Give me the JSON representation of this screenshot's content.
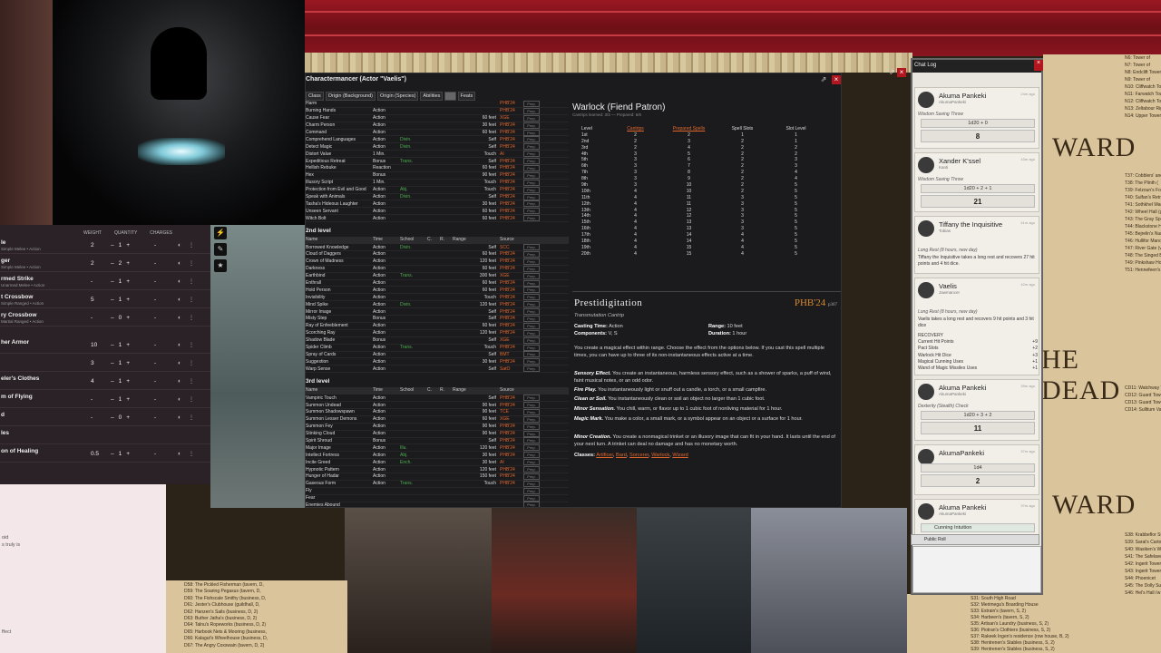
{
  "sheet": {
    "title": "Charactermancer (Actor \"Vaelis\")",
    "tabs": [
      "Class",
      "Origin (Background)",
      "Origin (Species)",
      "Abilities",
      "Feats",
      "Feats"
    ],
    "level1": [
      [
        "Harm",
        "",
        "",
        "",
        "",
        "PHB'24"
      ],
      [
        "Burning Hands",
        "Action",
        "",
        "",
        "",
        "PHB'24"
      ],
      [
        "Cause Fear",
        "Action",
        "",
        "",
        "60 feet",
        "XGE"
      ],
      [
        "Charm Person",
        "Action",
        "",
        "",
        "30 feet",
        "PHB'24"
      ],
      [
        "Command",
        "Action",
        "",
        "",
        "60 feet",
        "PHB'24"
      ],
      [
        "Comprehend Languages",
        "Action",
        "Divin.",
        "",
        "Self",
        "PHB'24"
      ],
      [
        "Detect Magic",
        "Action",
        "Divin.",
        "",
        "Self",
        "PHB'24"
      ],
      [
        "Distort Value",
        "1 Min.",
        "",
        "",
        "Touch",
        "AI"
      ],
      [
        "Expeditious Retreat",
        "Bonus",
        "Trans.",
        "",
        "Self",
        "PHB'24"
      ],
      [
        "Hellish Rebuke",
        "Reaction",
        "",
        "",
        "60 feet",
        "PHB'24"
      ],
      [
        "Hex",
        "Bonus",
        "",
        "",
        "90 feet",
        "PHB'24"
      ],
      [
        "Illusory Script",
        "1 Min.",
        "",
        "",
        "Touch",
        "PHB'24"
      ],
      [
        "Protection from Evil and Good",
        "Action",
        "Abj.",
        "",
        "Touch",
        "PHB'24"
      ],
      [
        "Speak with Animals",
        "Action",
        "Divin.",
        "",
        "Self",
        "PHB'24"
      ],
      [
        "Tasha's Hideous Laughter",
        "Action",
        "",
        "",
        "30 feet",
        "PHB'24"
      ],
      [
        "Unseen Servant",
        "Action",
        "",
        "",
        "60 feet",
        "PHB'24"
      ],
      [
        "Witch Bolt",
        "Action",
        "",
        "",
        "60 feet",
        "PHB'24"
      ]
    ],
    "level2_label": "2nd level",
    "col_headers": {
      "name": "Name",
      "time": "Time",
      "school": "School",
      "c": "C.",
      "r": "R.",
      "range": "Range",
      "source": "Source"
    },
    "level2": [
      [
        "Borrowed Knowledge",
        "Action",
        "Divin.",
        "",
        "Self",
        "SCC"
      ],
      [
        "Cloud of Daggers",
        "Action",
        "",
        "",
        "60 feet",
        "PHB'24"
      ],
      [
        "Crown of Madness",
        "Action",
        "",
        "",
        "120 feet",
        "PHB'24"
      ],
      [
        "Darkness",
        "Action",
        "",
        "",
        "60 feet",
        "PHB'24"
      ],
      [
        "Earthbind",
        "Action",
        "Trans.",
        "",
        "300 feet",
        "XGE"
      ],
      [
        "Enthrall",
        "Action",
        "",
        "",
        "60 feet",
        "PHB'24"
      ],
      [
        "Hold Person",
        "Action",
        "",
        "",
        "60 feet",
        "PHB'24"
      ],
      [
        "Invisibility",
        "Action",
        "",
        "",
        "Touch",
        "PHB'24"
      ],
      [
        "Mind Spike",
        "Action",
        "Divin.",
        "",
        "120 feet",
        "PHB'24"
      ],
      [
        "Mirror Image",
        "Action",
        "",
        "",
        "Self",
        "PHB'24"
      ],
      [
        "Misty Step",
        "Bonus",
        "",
        "",
        "Self",
        "PHB'24"
      ],
      [
        "Ray of Enfeeblement",
        "Action",
        "",
        "",
        "60 feet",
        "PHB'24"
      ],
      [
        "Scorching Ray",
        "Action",
        "",
        "",
        "120 feet",
        "PHB'24"
      ],
      [
        "Shadow Blade",
        "Bonus",
        "",
        "",
        "Self",
        "XGE"
      ],
      [
        "Spider Climb",
        "Action",
        "Trans.",
        "",
        "Touch",
        "PHB'24"
      ],
      [
        "Spray of Cards",
        "Action",
        "",
        "",
        "Self",
        "BMT"
      ],
      [
        "Suggestion",
        "Action",
        "",
        "",
        "30 feet",
        "PHB'24"
      ],
      [
        "Warp Sense",
        "Action",
        "",
        "",
        "Self",
        "SatO"
      ]
    ],
    "level3_label": "3rd level",
    "level3": [
      [
        "Vampiric Touch",
        "Action",
        "",
        "",
        "Self",
        "PHB'24"
      ],
      [
        "Summon Undead",
        "Action",
        "",
        "",
        "90 feet",
        "PHB'24"
      ],
      [
        "Summon Shadowspawn",
        "Action",
        "",
        "",
        "90 feet",
        "TCE"
      ],
      [
        "Summon Lesser Demons",
        "Action",
        "",
        "",
        "60 feet",
        "XGE"
      ],
      [
        "Summon Fey",
        "Action",
        "",
        "",
        "90 feet",
        "PHB'24"
      ],
      [
        "Stinking Cloud",
        "Action",
        "",
        "",
        "90 feet",
        "PHB'24"
      ],
      [
        "Spirit Shroud",
        "Bonus",
        "",
        "",
        "Self",
        "PHB'24"
      ],
      [
        "Major Image",
        "Action",
        "Illu.",
        "",
        "120 feet",
        "PHB'24"
      ],
      [
        "Intellect Fortress",
        "Action",
        "Abj.",
        "",
        "30 feet",
        "PHB'24"
      ],
      [
        "Incite Greed",
        "Action",
        "Ench.",
        "",
        "30 feet",
        "AI"
      ],
      [
        "Hypnotic Pattern",
        "Action",
        "",
        "",
        "120 feet",
        "PHB'24"
      ],
      [
        "Hunger of Hadar",
        "Action",
        "",
        "",
        "150 feet",
        "PHB'24"
      ],
      [
        "Gaseous Form",
        "Action",
        "Trans.",
        "",
        "Touch",
        "PHB'24"
      ],
      [
        "Fly",
        "",
        "",
        "",
        "",
        ""
      ],
      [
        "Fear",
        "",
        "",
        "",
        "",
        ""
      ],
      [
        "Enemies Abound",
        "",
        "",
        "",
        "",
        ""
      ],
      [
        "Tongues",
        "",
        "",
        "",
        "",
        ""
      ],
      [
        "Thunder Step",
        "",
        "",
        "",
        "",
        ""
      ],
      [
        "Remove Curse",
        "",
        "",
        "",
        "",
        ""
      ],
      [
        "Magic Circle",
        "",
        "",
        "",
        "",
        ""
      ],
      [
        "Fireball",
        "",
        "",
        "",
        "",
        ""
      ],
      [
        "Dispel Magic",
        "",
        "",
        "",
        "",
        ""
      ],
      [
        "Counterspell",
        "",
        "",
        "",
        "",
        ""
      ],
      [
        "Antagonize",
        "",
        "",
        "",
        "",
        ""
      ]
    ],
    "class_spells_label": "Class Spells (W",
    "innate_label": "Innate/Prepare",
    "innate_sub": "No spells at this le",
    "warlock": {
      "title": "Warlock (Fiend Patron)",
      "sub": "Cantrips learned: 3/3 — Prepared: 6/6",
      "headers": [
        "Level",
        "Cantrips",
        "Prepared Spells",
        "Spell Slots",
        "Slot Level"
      ],
      "rows": [
        [
          "1st",
          "2",
          "2",
          "1",
          "1"
        ],
        [
          "2nd",
          "2",
          "3",
          "2",
          "1"
        ],
        [
          "3rd",
          "2",
          "4",
          "2",
          "2"
        ],
        [
          "4th",
          "3",
          "5",
          "2",
          "2"
        ],
        [
          "5th",
          "3",
          "6",
          "2",
          "3"
        ],
        [
          "6th",
          "3",
          "7",
          "2",
          "3"
        ],
        [
          "7th",
          "3",
          "8",
          "2",
          "4"
        ],
        [
          "8th",
          "3",
          "9",
          "2",
          "4"
        ],
        [
          "9th",
          "3",
          "10",
          "2",
          "5"
        ],
        [
          "10th",
          "4",
          "10",
          "2",
          "5"
        ],
        [
          "11th",
          "4",
          "11",
          "3",
          "5"
        ],
        [
          "12th",
          "4",
          "11",
          "3",
          "5"
        ],
        [
          "13th",
          "4",
          "12",
          "3",
          "5"
        ],
        [
          "14th",
          "4",
          "12",
          "3",
          "5"
        ],
        [
          "15th",
          "4",
          "13",
          "3",
          "5"
        ],
        [
          "16th",
          "4",
          "13",
          "3",
          "5"
        ],
        [
          "17th",
          "4",
          "14",
          "4",
          "5"
        ],
        [
          "18th",
          "4",
          "14",
          "4",
          "5"
        ],
        [
          "19th",
          "4",
          "15",
          "4",
          "5"
        ],
        [
          "20th",
          "4",
          "15",
          "4",
          "5"
        ]
      ]
    },
    "prest": {
      "name": "Prestidigitation",
      "source": "PHB'24",
      "source_page": "p307",
      "school": "Transmutation Cantrip",
      "casting_label": "Casting Time:",
      "casting": "Action",
      "range_label": "Range:",
      "range": "10 feet",
      "comp_label": "Components:",
      "comp": "V, S",
      "dur_label": "Duration:",
      "dur": "1 hour",
      "intro": "You create a magical effect within range. Choose the effect from the options below. If you cast this spell multiple times, you can have up to three of its non-instantaneous effects active at a time.",
      "e1b": "Sensory Effect.",
      "e1": " You create an instantaneous, harmless sensory effect, such as a shower of sparks, a puff of wind, faint musical notes, or an odd odor.",
      "e2b": "Fire Play.",
      "e2": " You instantaneously light or snuff out a candle, a torch, or a small campfire.",
      "e3b": "Clean or Soil.",
      "e3": " You instantaneously clean or soil an object no larger than 1 cubic foot.",
      "e4b": "Minor Sensation.",
      "e4": " You chill, warm, or flavor up to 1 cubic foot of nonliving material for 1 hour.",
      "e5b": "Magic Mark.",
      "e5": " You make a color, a small mark, or a symbol appear on an object or a surface for 1 hour.",
      "e6b": "Minor Creation.",
      "e6": " You create a nonmagical trinket or an illusory image that can fit in your hand. It lasts until the end of your next turn. A trinket can deal no damage and has no monetary worth.",
      "classes_label": "Classes:",
      "classes": [
        "Artificer",
        "Bard",
        "Sorcerer",
        "Warlock",
        "Wizard"
      ]
    }
  },
  "inventory": {
    "headers": [
      "Weight",
      "Quantity",
      "Charges"
    ],
    "rows": [
      {
        "name": "le",
        "sub": "Simple Melee • Action",
        "w": "2",
        "q": "1",
        "c": "-"
      },
      {
        "name": "ger",
        "sub": "Simple Melee • Action",
        "w": "2",
        "q": "2",
        "c": "-"
      },
      {
        "name": "rmed Strike",
        "sub": "Unarmed Melee • Action",
        "w": "-",
        "q": "1",
        "c": "-"
      },
      {
        "name": "t Crossbow",
        "sub": "Simple Ranged • Action",
        "w": "5",
        "q": "1",
        "c": "-"
      },
      {
        "name": "ry Crossbow",
        "sub": "Martial Ranged • Action",
        "w": "-",
        "q": "0",
        "c": "-"
      },
      {
        "name": "her Armor",
        "sub": "",
        "w": "10",
        "q": "1",
        "c": "-"
      },
      {
        "name": "",
        "sub": "",
        "w": "3",
        "q": "1",
        "c": "-"
      },
      {
        "name": "eler's Clothes",
        "sub": "",
        "w": "4",
        "q": "1",
        "c": "-"
      },
      {
        "name": "m of Flying",
        "sub": "",
        "w": "-",
        "q": "1",
        "c": "-"
      },
      {
        "name": "d",
        "sub": "",
        "w": "-",
        "q": "0",
        "c": "-"
      },
      {
        "name": "les",
        "sub": "",
        "w": "",
        "q": "",
        "c": ""
      },
      {
        "name": "on of Healing",
        "sub": "",
        "w": "0.5",
        "q": "1",
        "c": "-"
      }
    ]
  },
  "wand_text": [
    "oid",
    "s truly is",
    "ffect"
  ],
  "chat": {
    "title": "Chat Log",
    "cards": [
      {
        "name": "Akuma Pankeki",
        "alias": "AkumaPankeki",
        "time": "24m ago",
        "flavor": "Wisdom Saving Throw",
        "dice": "1d20 + 0",
        "total": "8"
      },
      {
        "name": "Xander K'ssel",
        "alias": "Kanti",
        "time": "43m ago",
        "flavor": "Wisdom Saving Throw",
        "dice": "1d20 + 2 + 1",
        "total": "21"
      },
      {
        "name": "Tiffany the Inquisitive",
        "alias": "Tobias",
        "time": "41m ago",
        "flavor": "Long Rest (8 hours, new day)",
        "text": "Tiffany the Inquisitive takes a long rest and recovers 27 hit points and 4 hit dice."
      },
      {
        "name": "Vaelis",
        "alias": "Jawmancer",
        "time": "42m ago",
        "flavor": "Long Rest (8 hours, new day)",
        "text": "Vaelis takes a long rest and recovers 9 hit points and 3 hit dice",
        "recovery_label": "RECOVERY",
        "recovery": [
          [
            "Current Hit Points",
            "+9"
          ],
          [
            "Pact Slots",
            "+2"
          ],
          [
            "Warlock Hit Dice",
            "+3"
          ],
          [
            "Magical Cunning Uses",
            "+1"
          ],
          [
            "Wand of Magic Missiles Uses",
            "+1"
          ]
        ]
      },
      {
        "name": "Akuma Pankeki",
        "alias": "AkumaPankeki",
        "time": "39m ago",
        "flavor": "Dexterity (Stealth) Check",
        "dice": "1d20 + 3 + 2",
        "total": "11"
      },
      {
        "name": "AkumaPankeki",
        "alias": "",
        "time": "37m ago",
        "flavor": "",
        "dice": "1d4",
        "total": "2"
      },
      {
        "name": "Akuma Pankeki",
        "alias": "AkumaPankeki",
        "time": "37m ago",
        "flavor": "",
        "feature": "Cunning Intuition"
      }
    ],
    "roll_mode": "Public Roll"
  },
  "map_right_top": [
    "T37: Cobblers' and",
    "T38: The Plinth (",
    "T39: Felzoun's Folly",
    "T40: Sulfan's Retre",
    "T41: Sothkhel Wareh",
    "T42: Wheel Hall (gu",
    "T43: The Gray Spe",
    "T44: Blackstone H",
    "T45: Bejrelin's Nurs",
    "T46: Hullifor Manor",
    "T47: River Gate (v",
    "T48: The Singed Bo",
    "T49: Pinkshaw Hou",
    "T51: Hennefeen's Cl"
  ],
  "map_right_top2": [
    "N6: Tower of",
    "N7: Tower of",
    "N8: Endclift Tower",
    "N9: Tower of",
    "N10: Cliffwatch Tow",
    "N11: Farwatch Tow",
    "N12: Cliffwatch Tow",
    "N13: Zeltabour Right",
    "N14: Upper Towers"
  ],
  "map_word1": "WARD",
  "map_word2": "HE DEAD",
  "map_word3": "WARD",
  "map_right_mid": [
    "CD11: Watchway To",
    "CD12: Guard Tower",
    "CD13: Guard Tower",
    "CD14: Sulltium Vault"
  ],
  "map_right_bot": [
    "S38: Krabbeflor Sti",
    "S39: Sarai's Cartog",
    "S40: Wasiken's Win",
    "S41: The Safelave",
    "S42: Ingerit Tower",
    "S43: Ingerit Tower",
    "S44: Phoenicet",
    "S45: The Dolly Sur",
    "S46: Hel's Hall (w",
    "S47: The Medusa's",
    "S48: Oriuthmerl's",
    "S49: Berendan's",
    "S50: Merimegst Ga",
    "S51: Formerly Pine"
  ],
  "map_bottom_left": [
    "D58: The Pickled Fisherman (tavern, D,",
    "D59: The Soaring Pegasus (tavern, D,",
    "D60: The Fishscale Smithy (business, D,",
    "D61: Jester's Clubhouse (guildhall, D,",
    "D62: Hanzen's Sails (business, D, 2)",
    "D63: Buther Jatha's (business, D, 2)",
    "D64: Talnu's Ropeworks (business, D, 2)",
    "D65: Harbook Nets & Mooring (business,",
    "D66: Kalagut's Wheelhouse (business, D,",
    "D67: The Angry Coxswain (tavern, D, 2)"
  ],
  "map_bottom_right": [
    "S31: South High Road",
    "S32: Merimega's Boarding House",
    "S33: Estrain's (tavern, S, 2)",
    "S34: Harbeen's (tavern, S, 2)",
    "S35: Artisan's Laundry (business, S, 2)",
    "S36: Piotran's Clothiers (business, S, 2)",
    "S37: Rakeek Ingen's residence (row house, B, 2)",
    "S38: Hentrenen's Stables (business, S, 2)",
    "S39: Hentrenen's Stables (business, S, 2)",
    "S36: Watch Guardpost (city building, B, 2)"
  ],
  "colors": {
    "accent": "#b3161f",
    "source": "#e0672c",
    "divin": "#4caf50",
    "abj": "#3a7be0",
    "phb": "#d8892b"
  }
}
